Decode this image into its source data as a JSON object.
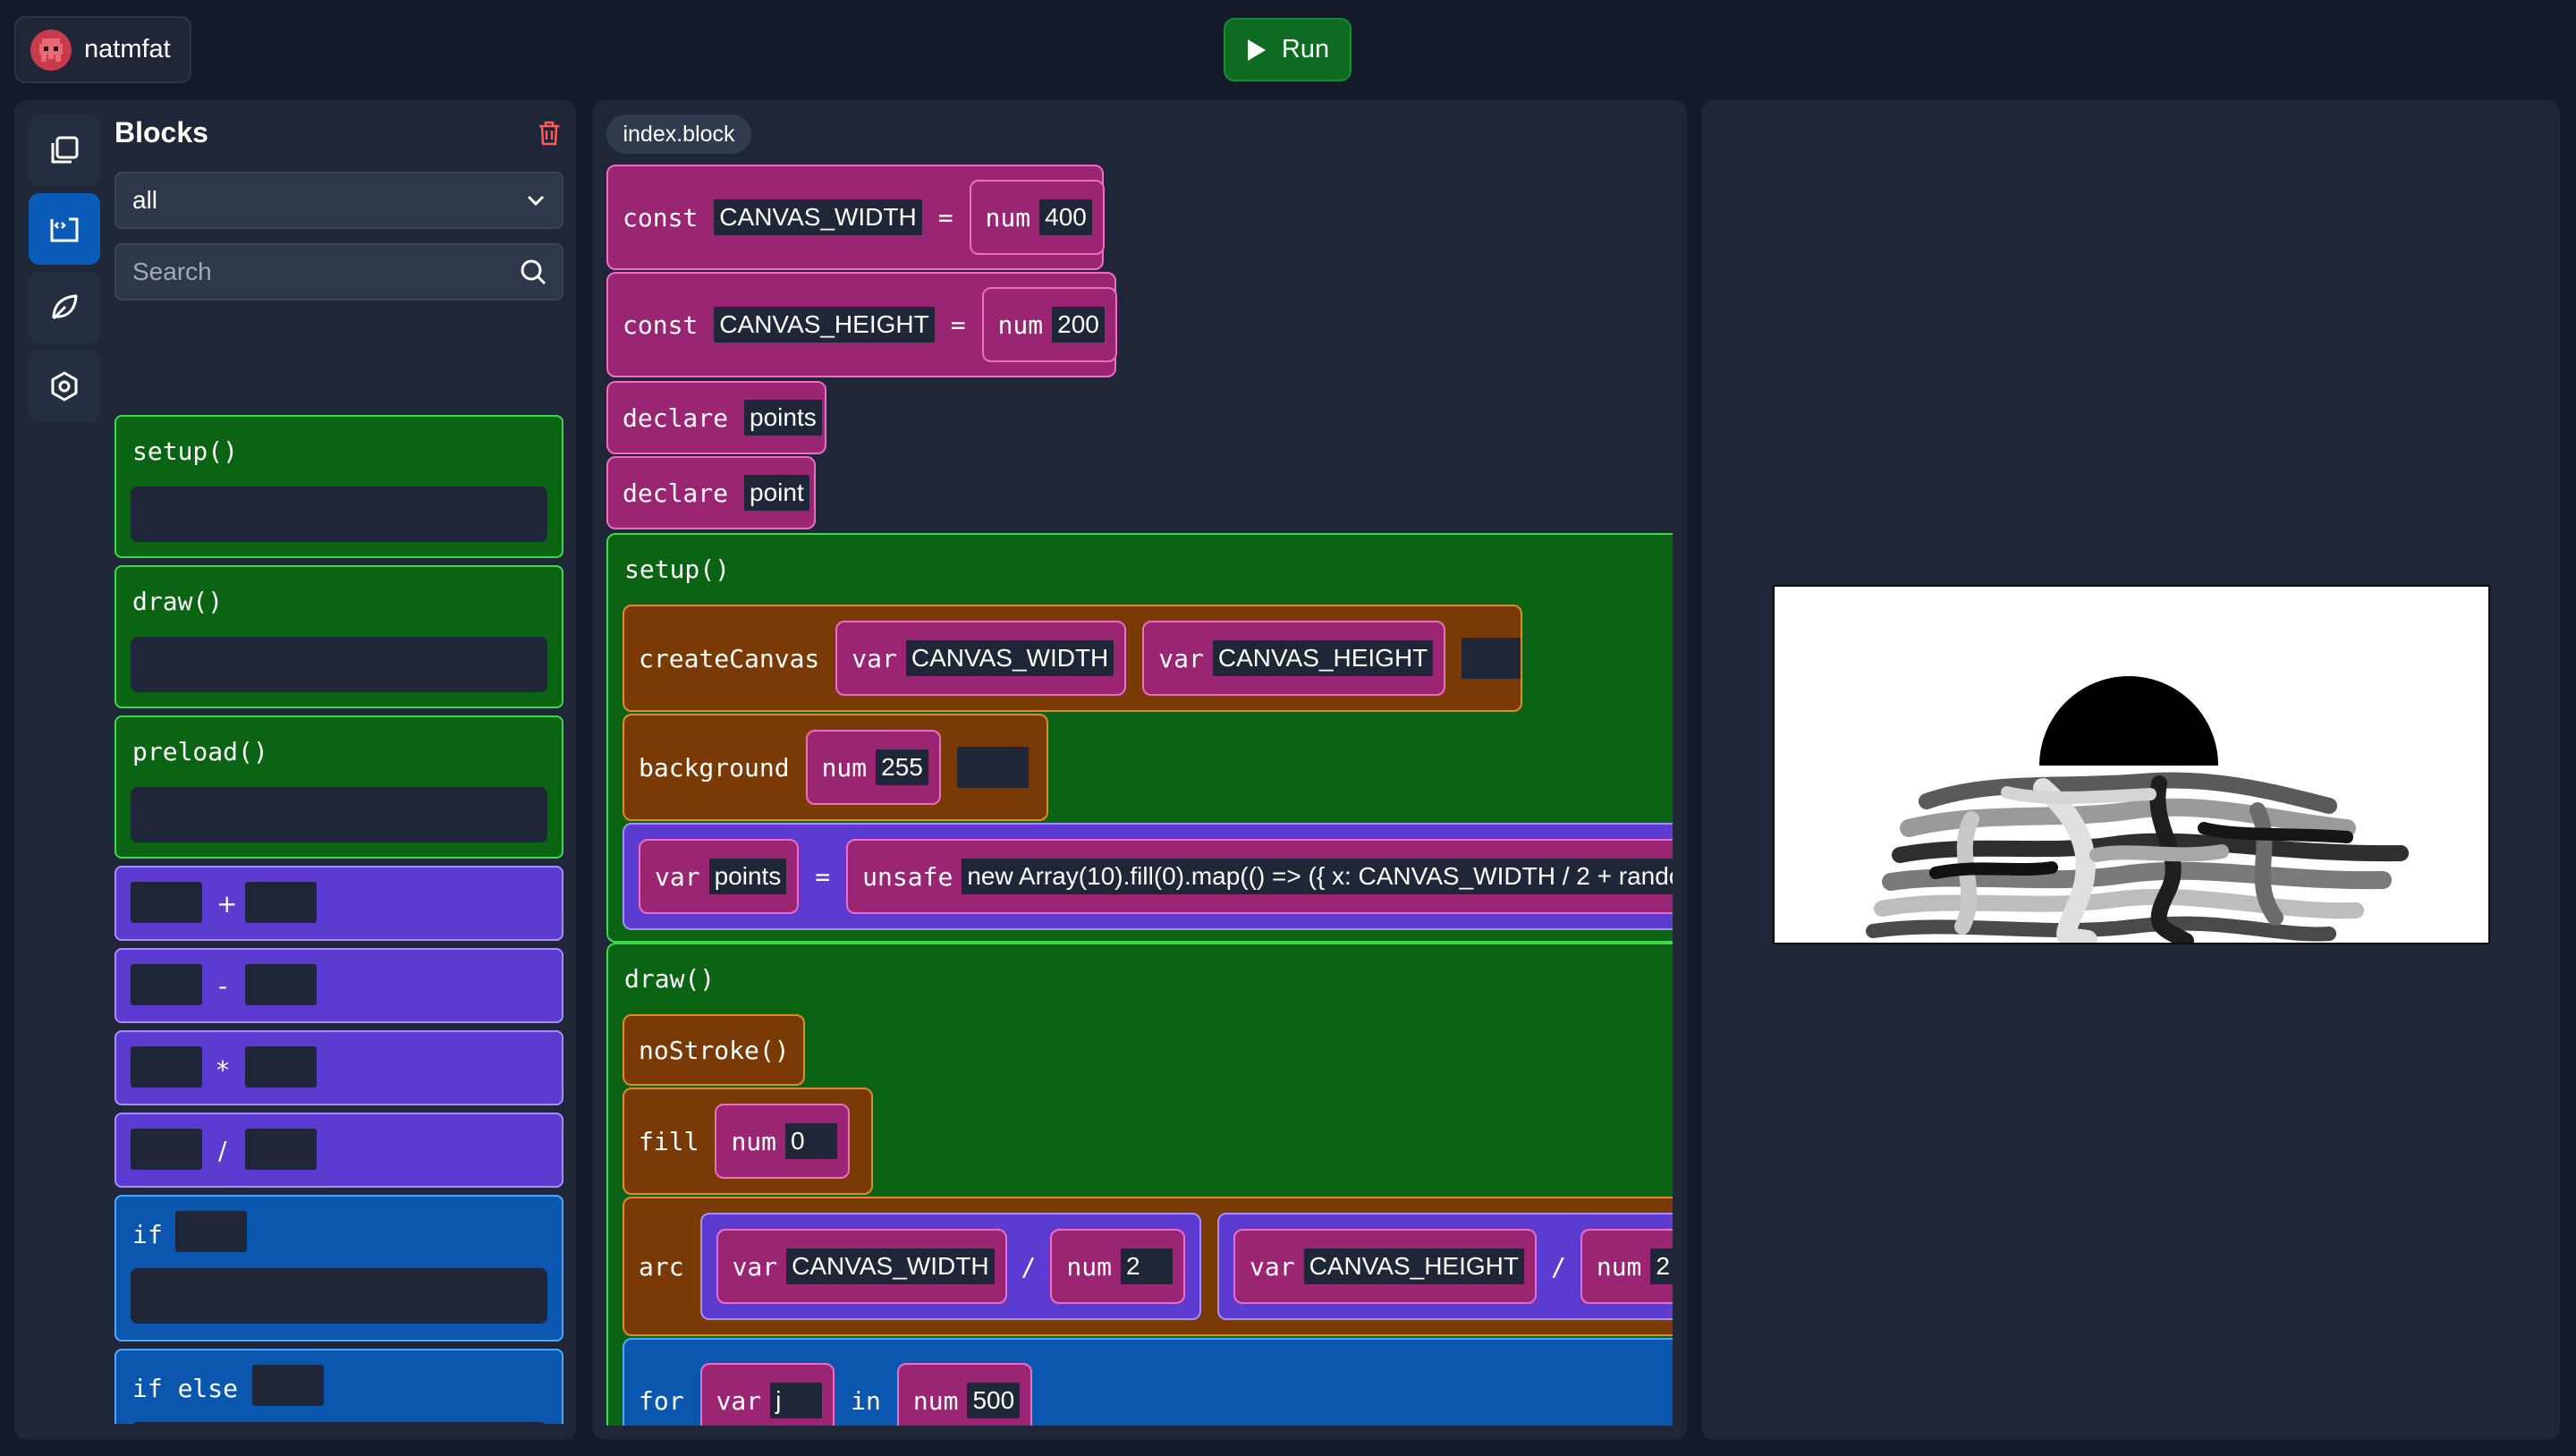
{
  "header": {
    "username": "natmfat",
    "run_label": "Run"
  },
  "sidebar": {
    "title": "Blocks",
    "filter_value": "all",
    "search_placeholder": "Search",
    "rail_icons": [
      "files-icon",
      "code-icon",
      "leaf-icon",
      "settings-icon"
    ],
    "palette": [
      {
        "kind": "function",
        "label": "setup()"
      },
      {
        "kind": "function",
        "label": "draw()"
      },
      {
        "kind": "function",
        "label": "preload()"
      },
      {
        "kind": "operator",
        "label": "+"
      },
      {
        "kind": "operator",
        "label": "-"
      },
      {
        "kind": "operator",
        "label": "*"
      },
      {
        "kind": "operator",
        "label": "/"
      },
      {
        "kind": "control",
        "label": "if"
      },
      {
        "kind": "control",
        "label": "if else"
      }
    ]
  },
  "editor": {
    "file_tab": "index.block",
    "const_kw": "const",
    "declare_kw": "declare",
    "num_kw": "num",
    "var_kw": "var",
    "unsafe_kw": "unsafe",
    "eq": "=",
    "div": "/",
    "in_kw": "in",
    "lines": {
      "c1_name": "CANVAS_WIDTH",
      "c1_value": "400",
      "c2_name": "CANVAS_HEIGHT",
      "c2_value": "200",
      "d1_name": "points",
      "d2_name": "point"
    },
    "setup": {
      "head": "setup()",
      "create_canvas": "createCanvas",
      "cc_arg1": "CANVAS_WIDTH",
      "cc_arg2": "CANVAS_HEIGHT",
      "background": "background",
      "bg_value": "255",
      "assign_var": "points",
      "unsafe_code": "new Array(10).fill(0).map(() => ({ x: CANVAS_WIDTH / 2 + rando"
    },
    "draw": {
      "head": "draw()",
      "no_stroke": "noStroke()",
      "fill": "fill",
      "fill_value": "0",
      "arc": "arc",
      "arc_a_var": "CANVAS_WIDTH",
      "arc_a_num": "2",
      "arc_b_var": "CANVAS_HEIGHT",
      "arc_b_num": "2",
      "for_kw": "for",
      "for_var": "j",
      "for_num": "500"
    }
  },
  "colors": {
    "function_block": "#0b6414",
    "operator_block": "#5b3bd0",
    "control_block": "#0b57b0",
    "declaration_block": "#9a2572",
    "command_block": "#7a3a06",
    "run_button": "#0e6b22"
  }
}
